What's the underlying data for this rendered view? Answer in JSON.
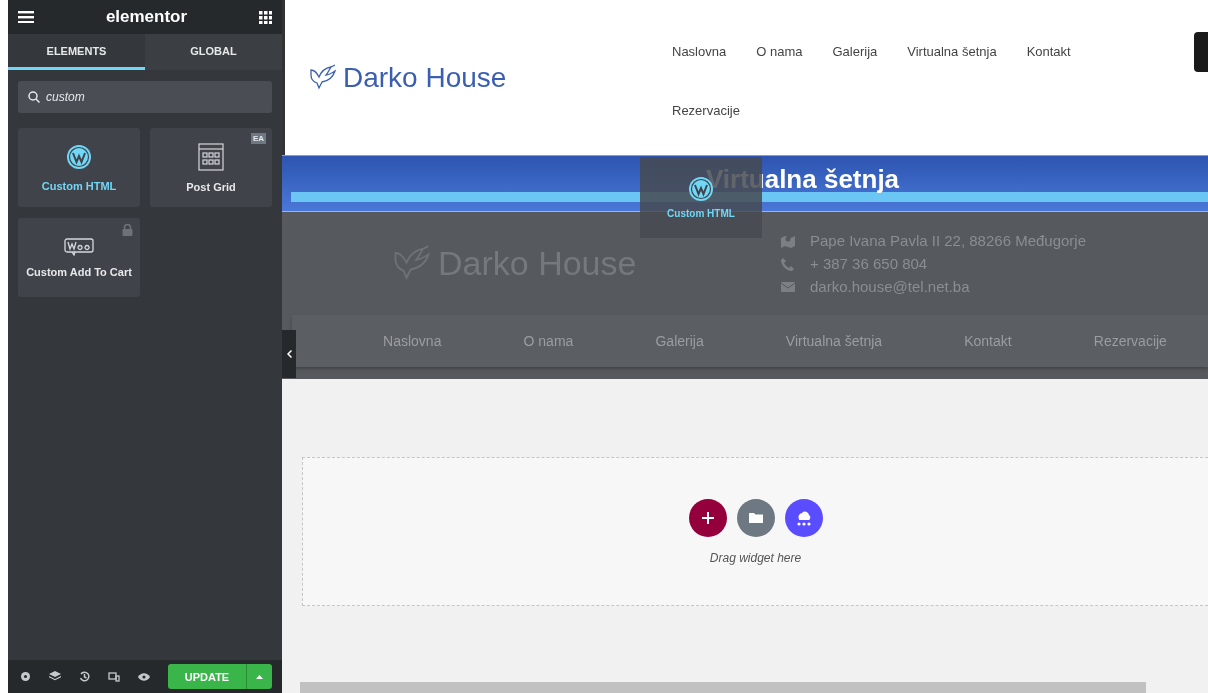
{
  "panel": {
    "brand": "elementor",
    "tabs": [
      {
        "label": "ELEMENTS",
        "selected": true
      },
      {
        "label": "GLOBAL",
        "selected": false
      }
    ],
    "search": {
      "value": "custom"
    },
    "widgets": [
      {
        "label": "Custom HTML",
        "highlighted": true,
        "locked": false
      },
      {
        "label": "Post Grid",
        "highlighted": false,
        "badge": "EA",
        "locked": false
      },
      {
        "label": "Custom Add To Cart",
        "highlighted": false,
        "locked": true
      }
    ],
    "footer": {
      "update_button": "UPDATE"
    }
  },
  "site": {
    "logo": "Darko House",
    "nav": [
      "Naslovna",
      "O nama",
      "Galerija",
      "Virtualna šetnja",
      "Kontakt",
      "Rezervacije"
    ],
    "banner_title": "Virtualna šetnja",
    "drag_ghost": {
      "label": "Custom HTML"
    },
    "dim_logo": "Darko House",
    "contacts": [
      {
        "kind": "map",
        "text": "Pape Ivana Pavla II 22, 88266 Međugorje"
      },
      {
        "kind": "phone",
        "text": "+ 387 36 650 804"
      },
      {
        "kind": "mail",
        "text": "darko.house@tel.net.ba"
      }
    ],
    "dim_nav": [
      "Naslovna",
      "O nama",
      "Galerija",
      "Virtualna šetnja",
      "Kontakt",
      "Rezervacije"
    ],
    "drop_zone": {
      "hint": "Drag widget here"
    }
  }
}
